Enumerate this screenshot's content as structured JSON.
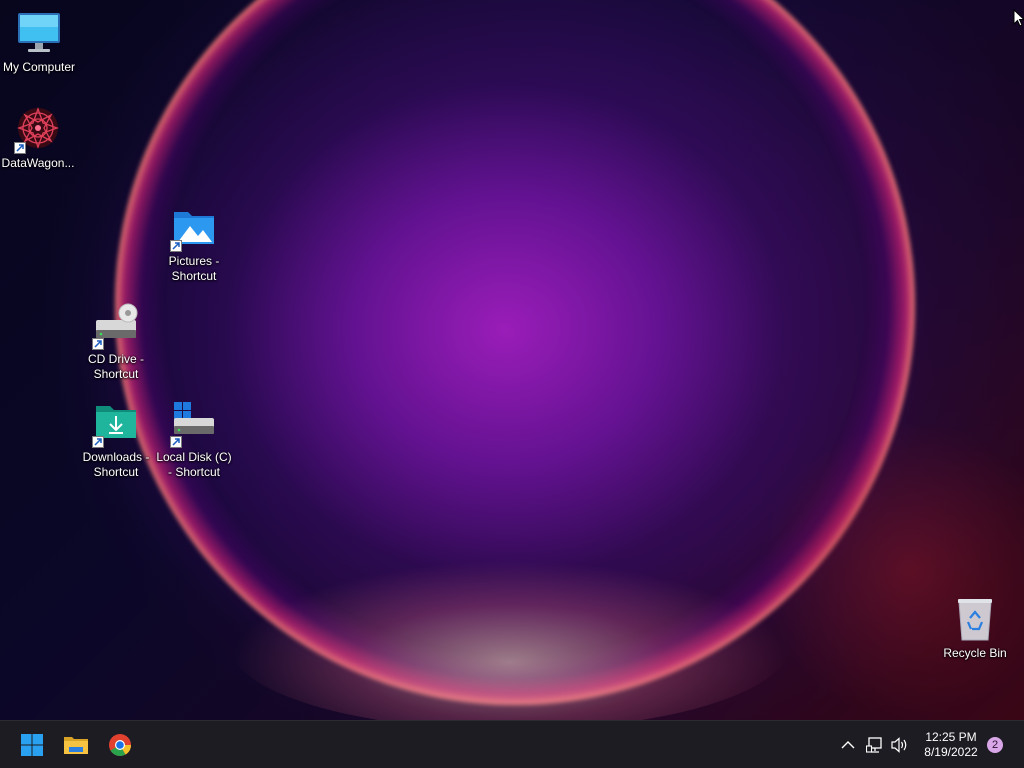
{
  "desktop": {
    "icons": {
      "my_computer": "My Computer",
      "datawagon": "DataWagon...",
      "pictures": "Pictures - Shortcut",
      "cd_drive": "CD Drive - Shortcut",
      "downloads": "Downloads - Shortcut",
      "local_disk": "Local Disk (C) - Shortcut",
      "recycle_bin": "Recycle Bin"
    }
  },
  "taskbar": {
    "pinned": [
      "start-icon",
      "file-explorer-icon",
      "chrome-icon"
    ],
    "tray": [
      "chevron-up-icon",
      "network-icon",
      "volume-icon"
    ],
    "time": "12:25 PM",
    "date": "8/19/2022",
    "notification_count": "2"
  },
  "colors": {
    "taskbar_bg": "#1c1c22",
    "start_blue": "#2aa0f0",
    "folder_yellow": "#f5c242",
    "notification_badge": "#d9a6e8"
  }
}
